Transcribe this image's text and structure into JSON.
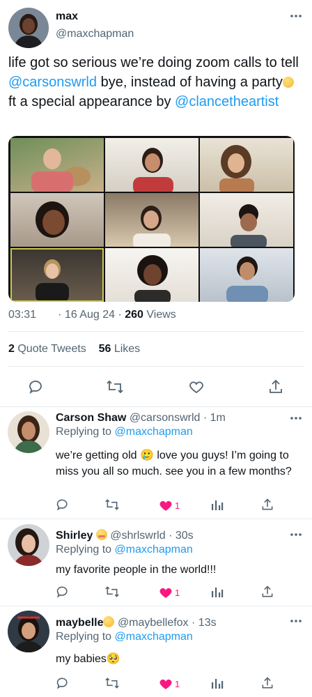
{
  "main_tweet": {
    "name": "max",
    "handle": "@maxchapman",
    "text_parts": {
      "t1": "life got so serious we’re doing zoom calls to tell ",
      "m1": "@carsonswrld",
      "t2": " bye, instead of having a party",
      "t3": "  ft a special appearance by ",
      "m2": "@clancetheartist"
    },
    "video_time": "03:31",
    "date": "· 16 Aug 24 ·",
    "views_count": "260",
    "views_label": "Views",
    "quote_count": "2",
    "quote_label": "Quote Tweets",
    "likes_count": "56",
    "likes_label": "Likes",
    "icons": [
      "reply-icon",
      "retweet-icon",
      "heart-icon",
      "share-icon"
    ]
  },
  "replies": [
    {
      "name": "Carson Shaw",
      "handle": "@carsonswrld",
      "time": "· 1m",
      "replying_label": "Replying to",
      "replying_to": "@maxchapman",
      "text": "we’re getting old 🥲  love you guys! I’m going to miss you all so much. see you in a few months?",
      "likes": "1"
    },
    {
      "name": "Shirley",
      "handle": "@shrlswrld",
      "time": "· 30s",
      "replying_label": "Replying to",
      "replying_to": "@maxchapman",
      "text": "my favorite people in the world!!!",
      "likes": "1"
    },
    {
      "name": "maybelle",
      "handle": "@maybellefox",
      "time": "· 13s",
      "replying_label": "Replying to",
      "replying_to": "@maxchapman",
      "text": "my babies🥺",
      "likes": "1"
    }
  ],
  "colors": {
    "link": "#1d9bf0",
    "like": "#f91880",
    "muted": "#536471",
    "divider": "#e6ecf0"
  }
}
